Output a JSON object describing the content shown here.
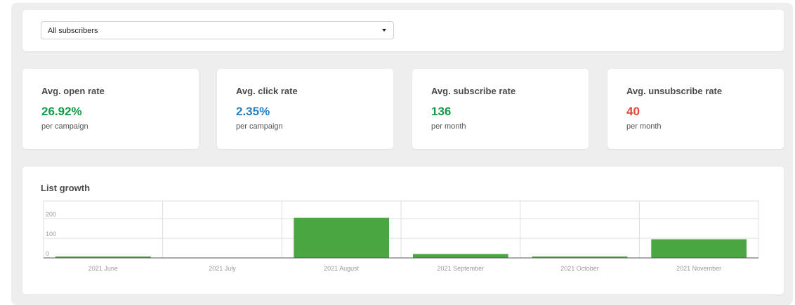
{
  "filter": {
    "selected": "All subscribers"
  },
  "stats": [
    {
      "label": "Avg. open rate",
      "value": "26.92%",
      "sub": "per campaign",
      "color": "#169b4b"
    },
    {
      "label": "Avg. click rate",
      "value": "2.35%",
      "sub": "per campaign",
      "color": "#2a7fc0"
    },
    {
      "label": "Avg. subscribe rate",
      "value": "136",
      "sub": "per month",
      "color": "#169b4b"
    },
    {
      "label": "Avg. unsubscribe rate",
      "value": "40",
      "sub": "per month",
      "color": "#e0483a"
    }
  ],
  "chart_title": "List growth",
  "chart_data": {
    "type": "bar",
    "title": "List growth",
    "categories": [
      "2021 June",
      "2021 July",
      "2021 August",
      "2021 September",
      "2021 October",
      "2021 November"
    ],
    "values": [
      5,
      0,
      205,
      20,
      7,
      95
    ],
    "yticks": [
      0,
      100,
      200
    ],
    "ylim": [
      0,
      290
    ],
    "grid": true,
    "bar_color": "#4aa640"
  }
}
